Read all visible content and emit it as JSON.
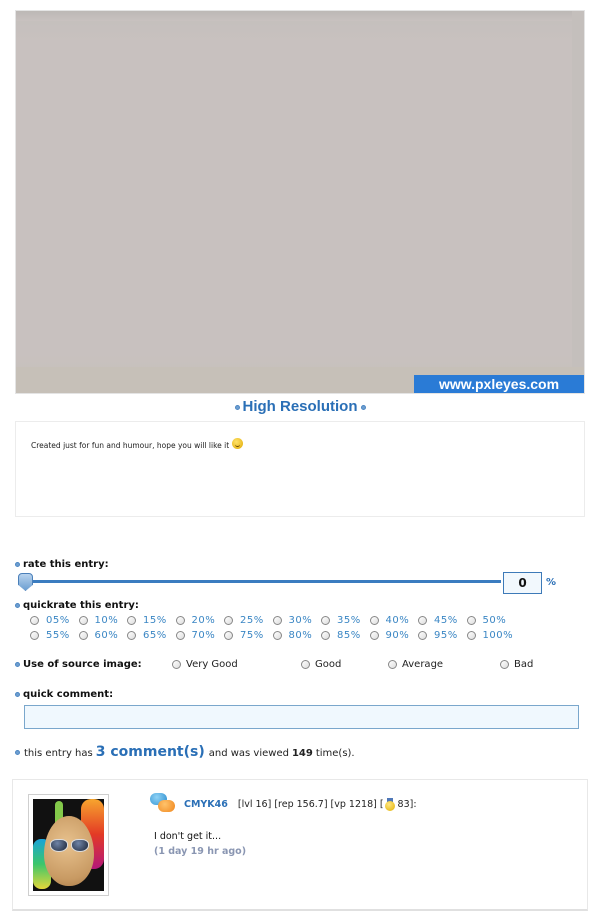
{
  "entry_image": {
    "watermark": "www.pxleyes.com"
  },
  "high_resolution_link": "High Resolution",
  "description": {
    "text": "Created just for fun and humour, hope you will like it",
    "emoticon": "wink-smiley-icon"
  },
  "rating": {
    "label": "rate this entry:",
    "value": "0",
    "percent_sign": "%",
    "slider_fraction": 0
  },
  "quickrate": {
    "label": "quickrate this entry:",
    "options": [
      "05%",
      "10%",
      "15%",
      "20%",
      "25%",
      "30%",
      "35%",
      "40%",
      "45%",
      "50%",
      "55%",
      "60%",
      "65%",
      "70%",
      "75%",
      "80%",
      "85%",
      "90%",
      "95%",
      "100%"
    ]
  },
  "source_usage": {
    "label": "Use of source image:",
    "options": [
      "Very Good",
      "Good",
      "Average",
      "Bad"
    ]
  },
  "quick_comment": {
    "label": "quick comment:",
    "value": "",
    "placeholder": ""
  },
  "stats": {
    "prefix": "this entry has",
    "comments_link": "3 comment(s)",
    "middle": "and was viewed",
    "views": "149",
    "suffix": "time(s)."
  },
  "comments": [
    {
      "user": "CMYK46",
      "meta_before_medal": "[lvl 16] [rep 156.7] [vp 1218] [",
      "medal_count": "83]:",
      "text": "I don't get it...",
      "time": "(1 day 19 hr ago)"
    }
  ],
  "colors": {
    "accent_blue": "#2a6fb6",
    "watermark_bg": "#2a7bd6",
    "link_light_blue": "#3a86c4",
    "input_bg": "#f0f8fe"
  }
}
